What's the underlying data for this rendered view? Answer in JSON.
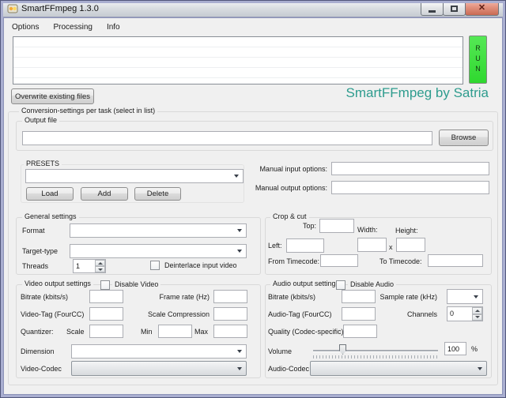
{
  "window": {
    "title": "SmartFFmpeg 1.3.0"
  },
  "menu": {
    "options": "Options",
    "processing": "Processing",
    "info": "Info"
  },
  "toolbar": {
    "run_label": "RUN",
    "overwrite_label": "Overwrite existing files",
    "credit": "SmartFFmpeg by Satria"
  },
  "main_group": {
    "label": "Conversion-settings per task (select in list)"
  },
  "output": {
    "group_label": "Output file",
    "file_value": "",
    "browse_label": "Browse"
  },
  "presets": {
    "label": "PRESETS",
    "selected_value": "",
    "load_label": "Load",
    "add_label": "Add",
    "delete_label": "Delete"
  },
  "manual": {
    "input_label": "Manual input options:",
    "input_value": "",
    "output_label": "Manual output options:",
    "output_value": ""
  },
  "general": {
    "label": "General settings",
    "format_label": "Format",
    "format_value": "",
    "target_label": "Target-type",
    "target_value": "",
    "threads_label": "Threads",
    "threads_value": "1",
    "deinterlace_label": "Deinterlace input video"
  },
  "crop": {
    "label": "Crop & cut",
    "top_label": "Top:",
    "top_value": "",
    "width_label": "Width:",
    "height_label": "Height:",
    "left_label": "Left:",
    "left_value": "",
    "width_value": "",
    "height_value": "",
    "x_separator": "x",
    "from_label": "From Timecode:",
    "from_value": "",
    "to_label": "To Timecode:",
    "to_value": ""
  },
  "video": {
    "label": "Video output settings",
    "disable_label": "Disable Video",
    "bitrate_label": "Bitrate (kbits/s)",
    "bitrate_value": "",
    "framerate_label": "Frame rate (Hz)",
    "framerate_value": "",
    "tag_label": "Video-Tag (FourCC)",
    "tag_value": "",
    "scale_compression_label": "Scale Compression",
    "scale_compression_value": "",
    "quantizer_label": "Quantizer:",
    "scale_label": "Scale",
    "scale_value": "",
    "min_label": "Min",
    "min_value": "",
    "max_label": "Max",
    "max_value": "",
    "dimension_label": "Dimension",
    "dimension_value": "",
    "codec_label": "Video-Codec",
    "codec_value": ""
  },
  "audio": {
    "label": "Audio output settings",
    "disable_label": "Disable Audio",
    "bitrate_label": "Bitrate (kbits/s)",
    "bitrate_value": "",
    "samplerate_label": "Sample rate (kHz)",
    "samplerate_value": "",
    "tag_label": "Audio-Tag (FourCC)",
    "tag_value": "",
    "channels_label": "Channels",
    "channels_value": "0",
    "quality_label": "Quality (Codec-specific)",
    "quality_value": "",
    "volume_label": "Volume",
    "volume_value": "100",
    "volume_unit": "%",
    "codec_label": "Audio-Codec",
    "codec_value": ""
  },
  "colors": {
    "run_green": "#3ce43c",
    "credit_teal": "#2e9c8e",
    "close_red": "#cf6a54",
    "window_border": "#a4a9cb"
  }
}
